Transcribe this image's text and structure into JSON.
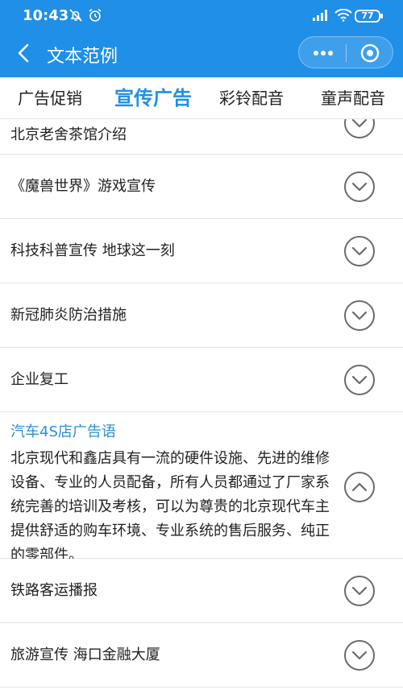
{
  "status_bar": {
    "time": "10:43",
    "battery": "77"
  },
  "nav": {
    "title": "文本范例"
  },
  "tabs": [
    {
      "label": "广告促销",
      "active": false
    },
    {
      "label": "宣传广告",
      "active": true
    },
    {
      "label": "彩铃配音",
      "active": false
    },
    {
      "label": "童声配音",
      "active": false
    }
  ],
  "items": [
    {
      "title": "北京老舍茶馆介绍",
      "expanded": false
    },
    {
      "title": "《魔兽世界》游戏宣传",
      "expanded": false
    },
    {
      "title": "科技科普宣传 地球这一刻",
      "expanded": false
    },
    {
      "title": "新冠肺炎防治措施",
      "expanded": false
    },
    {
      "title": "企业复工",
      "expanded": false
    },
    {
      "title": "汽车4S店广告语",
      "expanded": true,
      "body": "北京现代和鑫店具有一流的硬件设施、先进的维修设备、专业的人员配备，所有人员都通过了厂家系统完善的培训及考核，可以为尊贵的北京现代车主提供舒适的购车环境、专业系统的售后服务、纯正的零部件。"
    },
    {
      "title": "铁路客运播报",
      "expanded": false
    },
    {
      "title": "旅游宣传 海口金融大厦",
      "expanded": false
    }
  ],
  "colors": {
    "primary": "#1f8fe8",
    "category_label": "#2b8fd8",
    "divider": "#e3e3e3"
  }
}
